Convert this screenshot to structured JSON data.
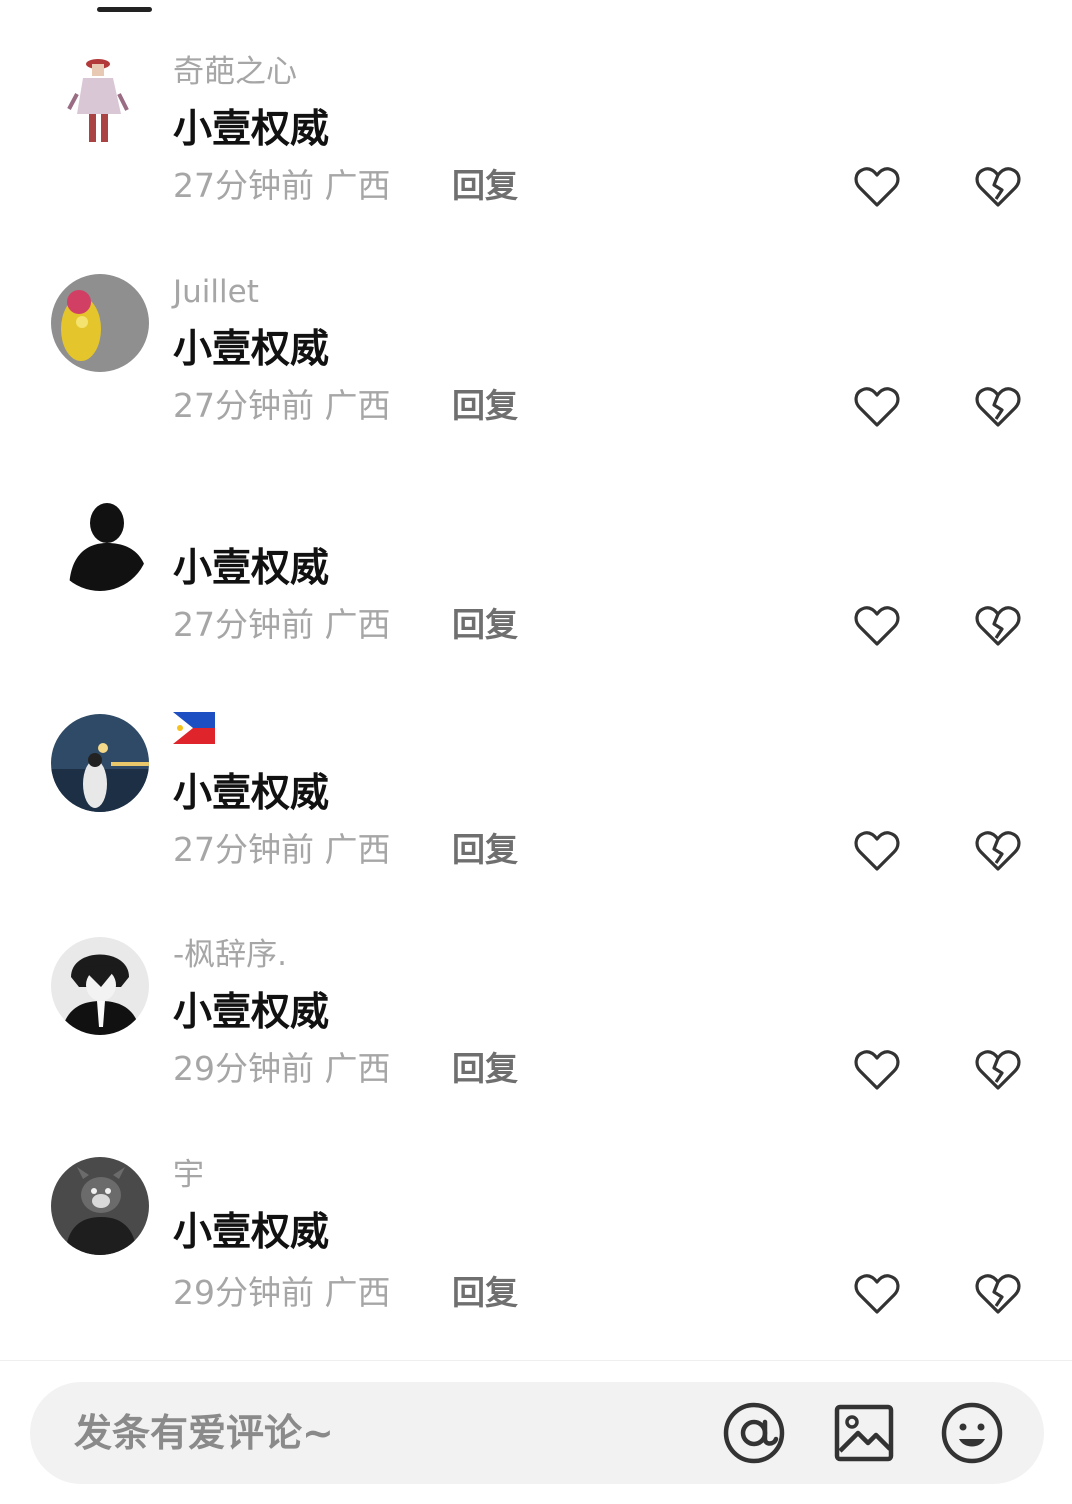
{
  "comments": [
    {
      "username": "奇葩之心",
      "text": "小壹权威",
      "time": "27分钟前",
      "region": "广西",
      "reply_label": "回复",
      "avatar": "figure-costume-avatar"
    },
    {
      "username": "Juillet",
      "text": "小壹权威",
      "time": "27分钟前",
      "region": "广西",
      "reply_label": "回复",
      "avatar": "yellow-doll-avatar"
    },
    {
      "username": "",
      "text": "小壹权威",
      "time": "27分钟前",
      "region": "广西",
      "reply_label": "回复",
      "avatar": "silhouette-avatar"
    },
    {
      "username": "🇵🇭",
      "text": "小壹权威",
      "time": "27分钟前",
      "region": "广西",
      "reply_label": "回复",
      "avatar": "seaside-night-avatar"
    },
    {
      "username": "-枫辞序.",
      "text": "小壹权威",
      "time": "29分钟前",
      "region": "广西",
      "reply_label": "回复",
      "avatar": "anime-boy-avatar"
    },
    {
      "username": "宇",
      "text": "小壹权威",
      "time": "29分钟前",
      "region": "广西",
      "reply_label": "回复",
      "avatar": "cartoon-head-avatar"
    }
  ],
  "composer": {
    "placeholder": "发条有爱评论~",
    "icons": [
      "at-icon",
      "image-icon",
      "emoji-icon"
    ]
  },
  "colors": {
    "meta_text": "#a6a6a6",
    "reply_text": "#6f6f6f",
    "comment_text": "#111111",
    "composer_bg": "#f2f2f2"
  }
}
